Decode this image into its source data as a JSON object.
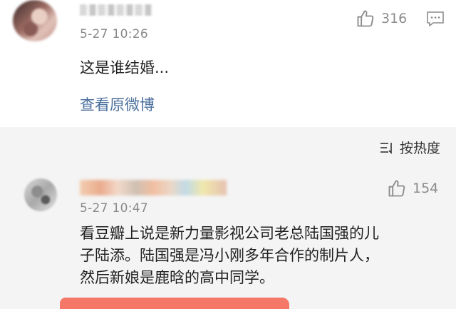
{
  "post": {
    "timestamp": "5-27 10:26",
    "like_count": "316",
    "text": "这是谁结婚...",
    "view_original": "查看原微博"
  },
  "sort": {
    "label": "按热度"
  },
  "comment": {
    "timestamp": "5-27 10:47",
    "like_count": "154",
    "lines": [
      "看豆瓣上说是新力量影视公司老总陆国强的儿",
      "子陆添。陆国强是冯小刚多年合作的制片人，",
      "然后新娘是鹿晗的高中同学。"
    ]
  },
  "icons": {
    "like": "thumbs-up-icon",
    "comment": "comment-icon",
    "sort": "sort-icon"
  },
  "colors": {
    "link": "#4a6e9c",
    "highlight": "#f4705f",
    "muted": "#8a8a8a"
  }
}
